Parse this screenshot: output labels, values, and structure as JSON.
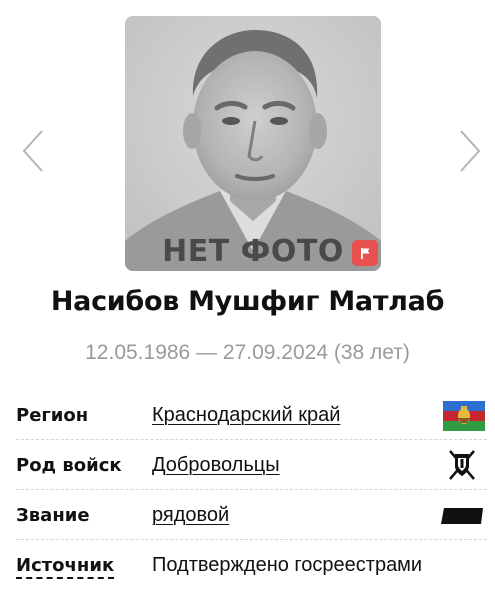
{
  "carousel": {
    "prev_icon": "chevron-left-icon",
    "next_icon": "chevron-right-icon"
  },
  "photo": {
    "caption": "НЕТ ФОТО",
    "badge_icon": "flag-icon",
    "badge_color": "#e8514f"
  },
  "person": {
    "name": "Насибов Мушфиг Матлаб",
    "dates": "12.05.1986 — 27.09.2024 (38 лет)"
  },
  "details": {
    "region": {
      "label": "Регион",
      "value": "Краснодарский край",
      "icon": "krasnodar-flag-icon"
    },
    "troops": {
      "label": "Род войск",
      "value": "Добровольцы",
      "icon": "volunteers-emblem-icon"
    },
    "rank": {
      "label": "Звание",
      "value": "рядовой",
      "icon": "rank-insignia-icon"
    },
    "source": {
      "label": "Источник",
      "value": "Подтверждено госреестрами"
    }
  },
  "colors": {
    "text": "#111111",
    "muted": "#9a9a9a",
    "accent_red": "#e8514f",
    "divider": "#d6d6d6"
  }
}
